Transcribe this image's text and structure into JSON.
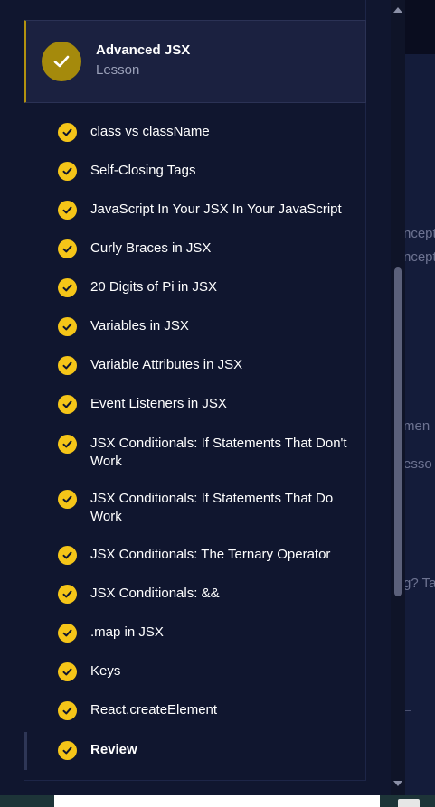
{
  "lesson": {
    "title": "Advanced JSX",
    "type": "Lesson"
  },
  "exercises": [
    {
      "label": "class vs className"
    },
    {
      "label": "Self-Closing Tags"
    },
    {
      "label": "JavaScript In Your JSX In Your JavaScript"
    },
    {
      "label": "Curly Braces in JSX"
    },
    {
      "label": "20 Digits of Pi in JSX"
    },
    {
      "label": "Variables in JSX"
    },
    {
      "label": "Variable Attributes in JSX"
    },
    {
      "label": "Event Listeners in JSX"
    },
    {
      "label": "JSX Conditionals: If Statements That Don't Work"
    },
    {
      "label": "JSX Conditionals: If Statements That Do Work"
    },
    {
      "label": "JSX Conditionals: The Ternary Operator"
    },
    {
      "label": "JSX Conditionals: &&"
    },
    {
      "label": ".map in JSX"
    },
    {
      "label": "Keys"
    },
    {
      "label": "React.createElement"
    },
    {
      "label": "Review"
    }
  ],
  "background_fragments": {
    "line1": "ncept",
    "line2": "ncept",
    "line3": "men",
    "line4": "esso",
    "line5": "g? Ta"
  },
  "colors": {
    "completed": "#f5c518",
    "lesson_badge": "#a58a0c",
    "active_accent": "#b3920f",
    "background": "#10162f"
  },
  "icons": {
    "completed": "check-circle-icon",
    "lesson": "check-circle-icon"
  }
}
